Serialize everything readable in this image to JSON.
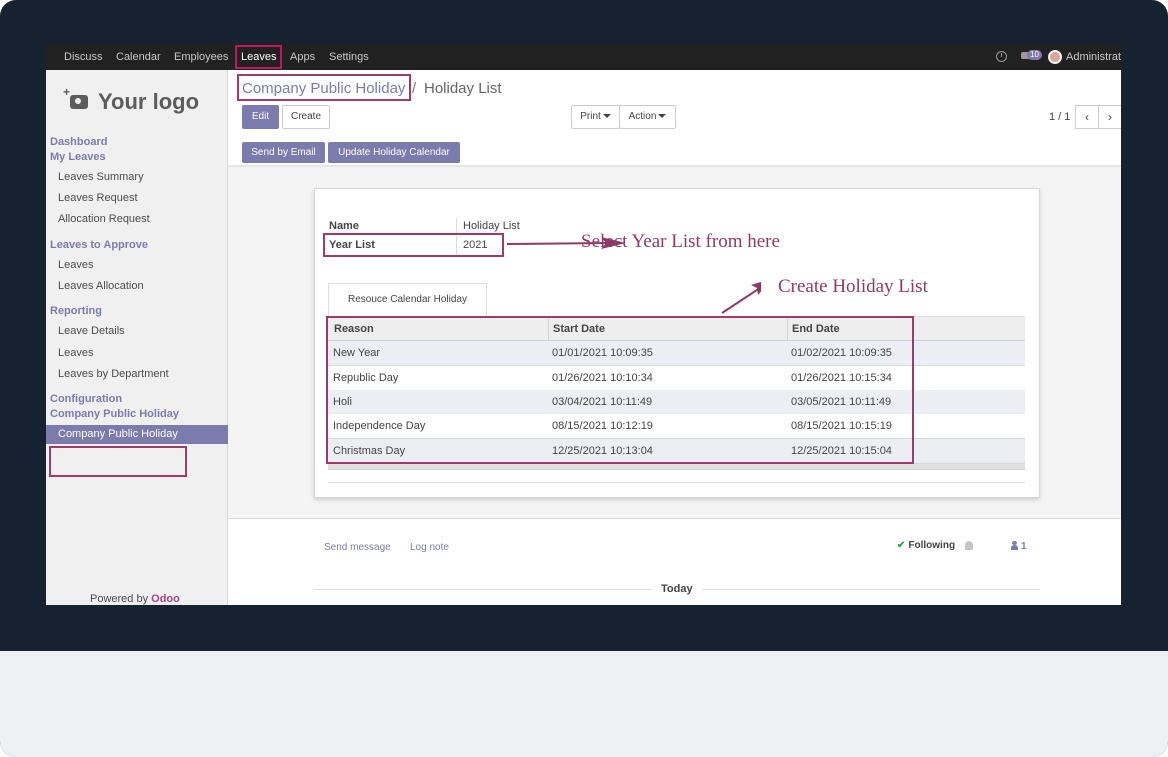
{
  "topbar": {
    "menu": [
      "Discuss",
      "Calendar",
      "Employees",
      "Leaves",
      "Apps",
      "Settings"
    ],
    "active": "Leaves",
    "chat_count": "10",
    "user": "Administrat"
  },
  "sidebar": {
    "logo": "Your logo",
    "sections": [
      {
        "heading": "Dashboard",
        "items": []
      },
      {
        "heading": "My Leaves",
        "items": [
          "Leaves Summary",
          "Leaves Request",
          "Allocation Request"
        ]
      },
      {
        "heading": "Leaves to Approve",
        "items": [
          "Leaves",
          "Leaves Allocation"
        ]
      },
      {
        "heading": "Reporting",
        "items": [
          "Leave Details",
          "Leaves",
          "Leaves by Department"
        ]
      },
      {
        "heading": "Configuration",
        "items": []
      },
      {
        "heading": "Company Public Holiday",
        "items": [
          "Company Public Holiday"
        ]
      }
    ],
    "powered_prefix": "Powered by",
    "powered_brand": "Odoo"
  },
  "breadcrumb": {
    "parent": "Company Public Holiday",
    "separator": "/",
    "current": "Holiday List"
  },
  "buttons": {
    "edit": "Edit",
    "create": "Create",
    "print": "Print",
    "action": "Action",
    "send_email": "Send by Email",
    "update_calendar": "Update Holiday Calendar"
  },
  "pager": {
    "value": "1 / 1",
    "prev": "‹",
    "next": "›"
  },
  "form": {
    "name_label": "Name",
    "name_value": "Holiday List",
    "year_label": "Year List",
    "year_value": "2021",
    "tab": "Resouce Calendar Holiday"
  },
  "table": {
    "headers": [
      "Reason",
      "Start Date",
      "End Date"
    ],
    "rows": [
      [
        "New Year",
        "01/01/2021 10:09:35",
        "01/02/2021 10:09:35"
      ],
      [
        "Republic Day",
        "01/26/2021 10:10:34",
        "01/26/2021 10:15:34"
      ],
      [
        "Holi",
        "03/04/2021 10:11:49",
        "03/05/2021 10:11:49"
      ],
      [
        "Independence Day",
        "08/15/2021 10:12:19",
        "08/15/2021 10:15:19"
      ],
      [
        "Christmas Day",
        "12/25/2021 10:13:04",
        "12/25/2021 10:15:04"
      ]
    ]
  },
  "annotations": {
    "year": "Select Year List from here",
    "list": "Create Holiday List"
  },
  "chatter": {
    "send_message": "Send message",
    "log_note": "Log note",
    "following": "Following",
    "followers": "1",
    "today": "Today"
  },
  "colors": {
    "accent": "#7c7bad",
    "highlight": "#a03a6a",
    "navbar": "#212121",
    "frame": "#162230"
  }
}
